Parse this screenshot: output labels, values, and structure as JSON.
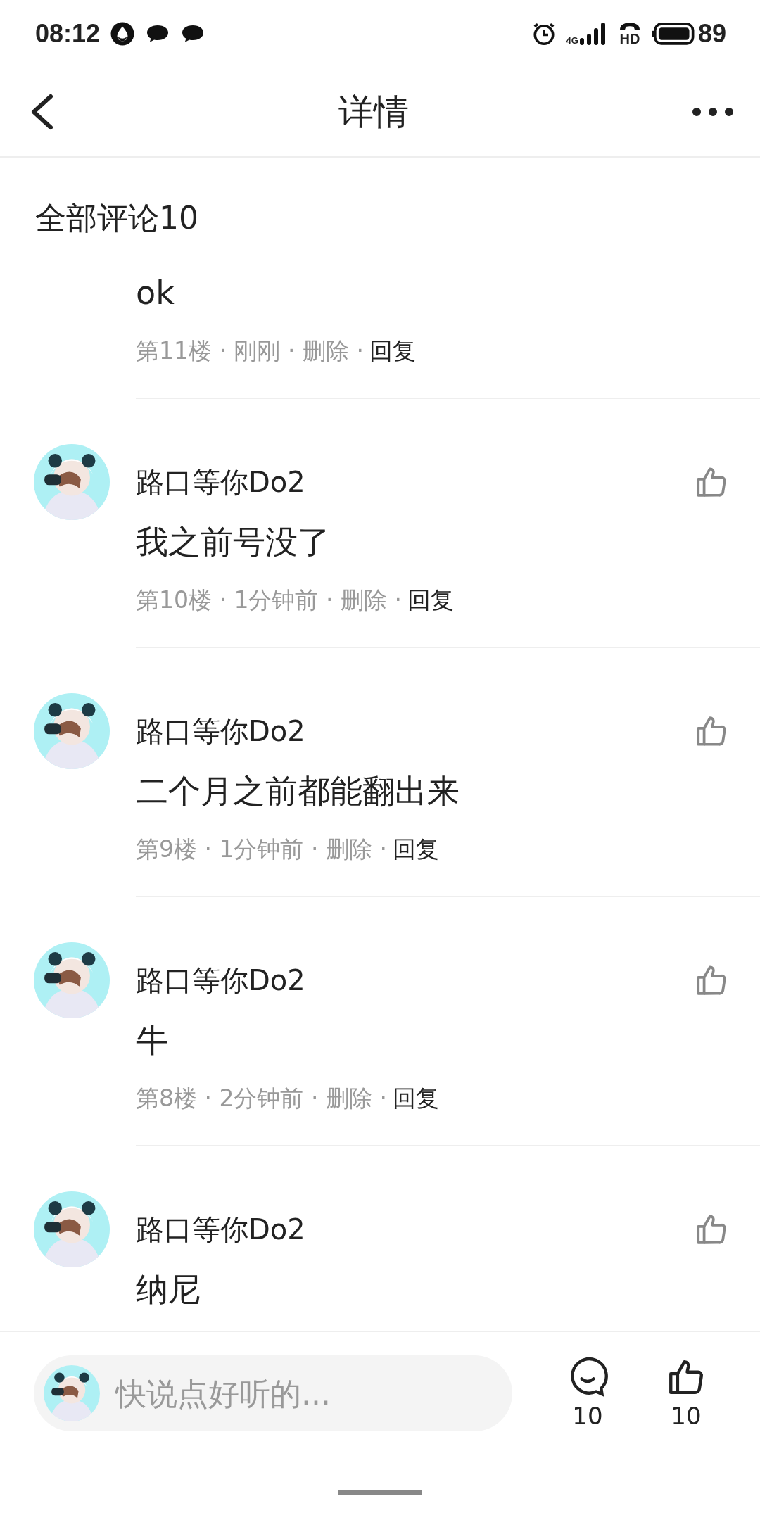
{
  "status_bar": {
    "time": "08:12",
    "network": "4G",
    "call": "HD",
    "battery": "89"
  },
  "header": {
    "title": "详情"
  },
  "comments_header": {
    "title": "全部评论10"
  },
  "comments": [
    {
      "kind": "partial",
      "content": "ok",
      "meta": "第11楼 · 刚刚 · 删除 ·",
      "reply": "回复"
    },
    {
      "kind": "full",
      "name": "路口等你Do2",
      "content": "我之前号没了",
      "meta": "第10楼 · 1分钟前 · 删除 ·",
      "reply": "回复"
    },
    {
      "kind": "full",
      "name": "路口等你Do2",
      "content": "二个月之前都能翻出来",
      "meta": "第9楼 · 1分钟前 · 删除 ·",
      "reply": "回复"
    },
    {
      "kind": "full",
      "name": "路口等你Do2",
      "content": "牛",
      "meta": "第8楼 · 2分钟前 · 删除 ·",
      "reply": "回复"
    },
    {
      "kind": "full",
      "name": "路口等你Do2",
      "content": "纳尼"
    }
  ],
  "bottom_bar": {
    "placeholder": "快说点好听的...",
    "comment_count": "10",
    "like_count": "10"
  }
}
